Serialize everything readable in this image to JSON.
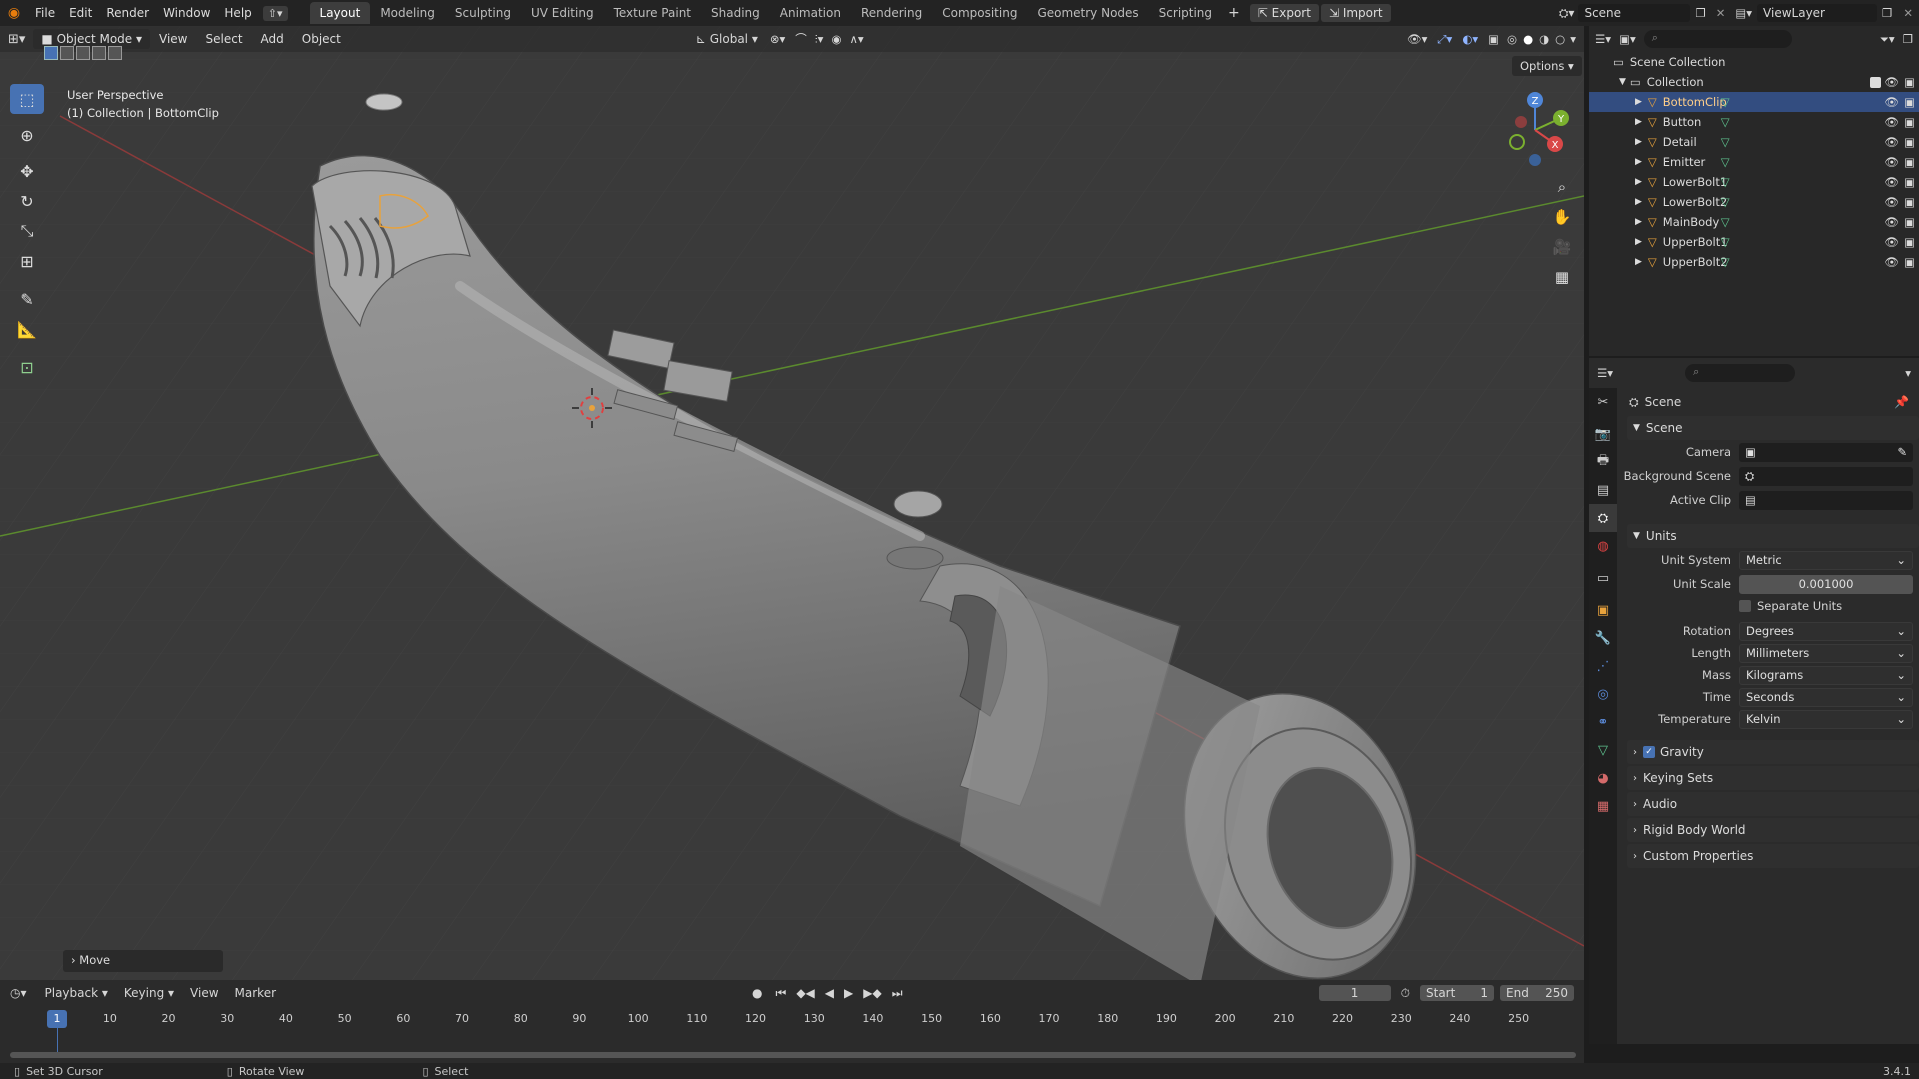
{
  "app": {
    "version": "3.4.1"
  },
  "topbar": {
    "menus": [
      "File",
      "Edit",
      "Render",
      "Window",
      "Help"
    ],
    "workspaces": [
      "Layout",
      "Modeling",
      "Sculpting",
      "UV Editing",
      "Texture Paint",
      "Shading",
      "Animation",
      "Rendering",
      "Compositing",
      "Geometry Nodes",
      "Scripting"
    ],
    "active_workspace": "Layout",
    "export_label": "Export",
    "import_label": "Import",
    "scene_name": "Scene",
    "view_layer": "ViewLayer"
  },
  "viewport": {
    "mode": "Object Mode",
    "menus": [
      "View",
      "Select",
      "Add",
      "Object"
    ],
    "orientation": "Global",
    "options_label": "Options",
    "overlay_title": "User Perspective",
    "overlay_subtitle": "(1) Collection | BottomClip",
    "last_op": "Move",
    "gizmo": {
      "z": "Z",
      "y": "Y",
      "x": "X"
    }
  },
  "outliner": {
    "root": "Scene Collection",
    "collection": "Collection",
    "items": [
      {
        "name": "BottomClip",
        "selected": true
      },
      {
        "name": "Button",
        "selected": false
      },
      {
        "name": "Detail",
        "selected": false
      },
      {
        "name": "Emitter",
        "selected": false
      },
      {
        "name": "LowerBolt1",
        "selected": false
      },
      {
        "name": "LowerBolt2",
        "selected": false
      },
      {
        "name": "MainBody",
        "selected": false
      },
      {
        "name": "UpperBolt1",
        "selected": false
      },
      {
        "name": "UpperBolt2",
        "selected": false
      }
    ]
  },
  "properties": {
    "context_title": "Scene",
    "scene_panel": "Scene",
    "camera_label": "Camera",
    "bg_scene_label": "Background Scene",
    "active_clip_label": "Active Clip",
    "units_panel": "Units",
    "unit_system_label": "Unit System",
    "unit_system": "Metric",
    "unit_scale_label": "Unit Scale",
    "unit_scale": "0.001000",
    "separate_units": "Separate Units",
    "rotation_label": "Rotation",
    "rotation": "Degrees",
    "length_label": "Length",
    "length": "Millimeters",
    "mass_label": "Mass",
    "mass": "Kilograms",
    "time_label": "Time",
    "time": "Seconds",
    "temperature_label": "Temperature",
    "temperature": "Kelvin",
    "collapsed_panels": [
      "Gravity",
      "Keying Sets",
      "Audio",
      "Rigid Body World",
      "Custom Properties"
    ]
  },
  "timeline": {
    "menus": [
      "Playback",
      "Keying",
      "View",
      "Marker"
    ],
    "current_frame": "1",
    "start_label": "Start",
    "start": "1",
    "end_label": "End",
    "end": "250",
    "ticks": [
      "1",
      "10",
      "20",
      "30",
      "40",
      "50",
      "60",
      "70",
      "80",
      "90",
      "100",
      "110",
      "120",
      "130",
      "140",
      "150",
      "160",
      "170",
      "180",
      "190",
      "200",
      "210",
      "220",
      "230",
      "240",
      "250"
    ]
  },
  "statusbar": {
    "hint1": "Set 3D Cursor",
    "hint2": "Rotate View",
    "hint3": "Select"
  },
  "colors": {
    "accent": "#4772b3",
    "selected_row": "#334d80",
    "object_orange": "#e8a23c",
    "mesh_green": "#5fc38f"
  }
}
